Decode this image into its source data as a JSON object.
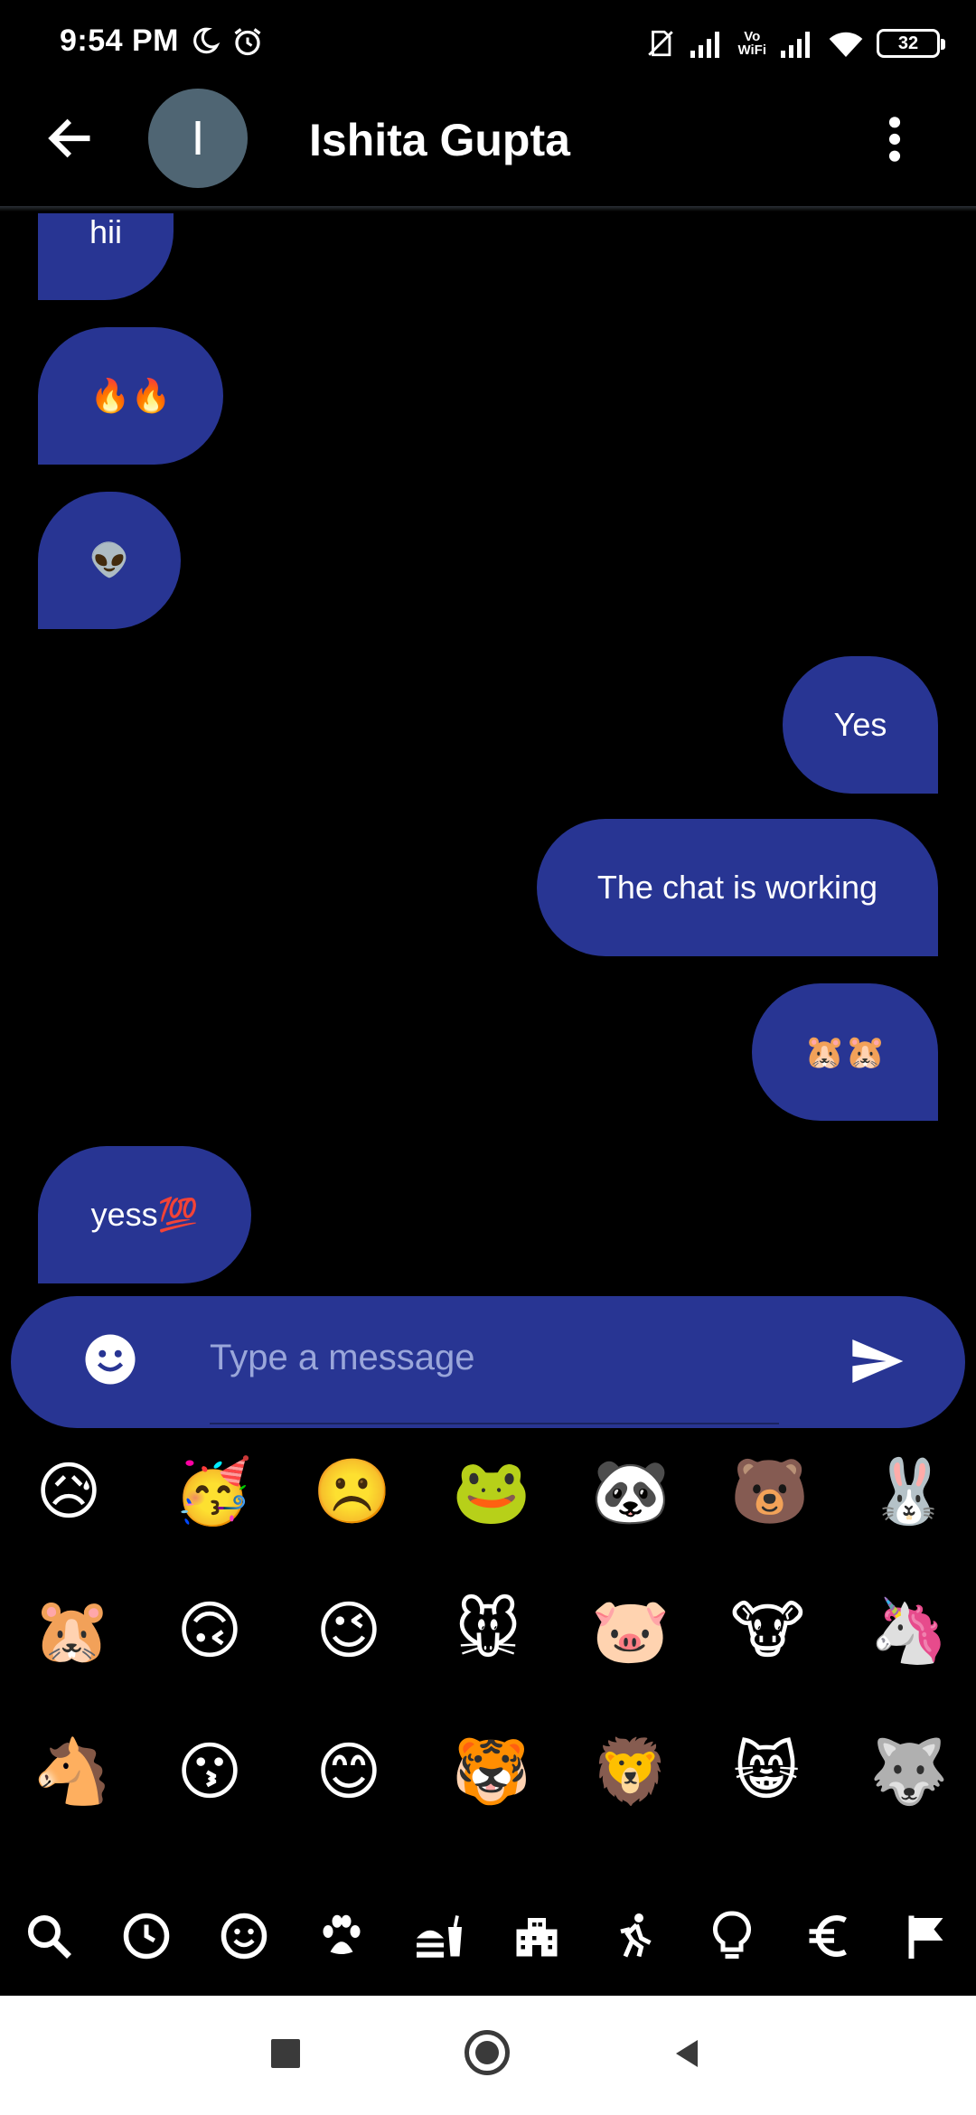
{
  "status_bar": {
    "time": "9:54 PM",
    "vowifi_top": "Vo",
    "vowifi_bottom": "WiFi",
    "battery": "32",
    "icons": [
      "moon-icon",
      "alarm-icon",
      "no-sim-icon",
      "signal-icon",
      "signal-icon",
      "wifi-icon",
      "battery-icon"
    ]
  },
  "header": {
    "avatar_initial": "I",
    "contact_name": "Ishita Gupta",
    "icons": [
      "back-arrow-icon",
      "more-vert-icon"
    ]
  },
  "messages": [
    {
      "direction": "in",
      "text": "hii"
    },
    {
      "direction": "in",
      "text": "🔥🔥"
    },
    {
      "direction": "in",
      "text": "👽"
    },
    {
      "direction": "out",
      "text": "Yes"
    },
    {
      "direction": "out",
      "text": "The chat is working"
    },
    {
      "direction": "out",
      "text": "🐹🐹"
    },
    {
      "direction": "in",
      "text": "yess💯"
    }
  ],
  "composer": {
    "placeholder": "Type a message",
    "icons": [
      "emoji-face-icon",
      "send-icon"
    ]
  },
  "emoji_picker": {
    "rows": [
      [
        "😥",
        "🥳",
        "☹️",
        "🐸",
        "🐼",
        "🐻",
        "🐰"
      ],
      [
        "🐹",
        "🙃",
        "😉",
        "🐭",
        "🐷",
        "🐮",
        "🦄"
      ],
      [
        "🐴",
        "😗",
        "😊",
        "🐯",
        "🦁",
        "😸",
        "🐺"
      ]
    ],
    "categories": [
      "search-icon",
      "recent-clock-icon",
      "smiley-icon",
      "paw-icon",
      "food-icon",
      "building-icon",
      "activity-run-icon",
      "lightbulb-icon",
      "euro-icon",
      "flag-icon"
    ]
  },
  "nav_bar": {
    "icons": [
      "recents-square-icon",
      "home-circle-icon",
      "back-triangle-icon"
    ]
  },
  "colors": {
    "bubble": "#283593",
    "background": "#000000",
    "placeholder": "#9aa6da"
  }
}
